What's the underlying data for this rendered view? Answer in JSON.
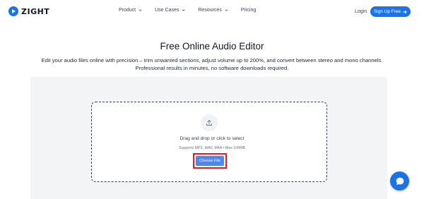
{
  "header": {
    "brand": "ZIGHT",
    "nav": [
      {
        "label": "Product",
        "has_dropdown": true
      },
      {
        "label": "Use Cases",
        "has_dropdown": true
      },
      {
        "label": "Resources",
        "has_dropdown": true
      },
      {
        "label": "Pricing",
        "has_dropdown": false
      }
    ],
    "login_label": "Login",
    "signup_label": "Sign Up Free"
  },
  "hero": {
    "title": "Free Online Audio Editor",
    "description": "Edit your audio files online with precision – trim unwanted sections, adjust volume up to 200%, and convert between stereo and mono channels. Professional results in minutes, no software downloads required."
  },
  "upload": {
    "drop_text": "Drag and drop or click to select",
    "supports_text": "Supports MP3, WAV, M4A • Max 100MB",
    "button_label": "Choose File"
  },
  "colors": {
    "brand_blue": "#1a73e8",
    "button_blue": "#4f86f0",
    "highlight_red": "#e11d2a",
    "panel_gray": "#f3f4f6"
  },
  "icons": {
    "logo": "zight-logo-icon",
    "upload": "upload-icon",
    "chat": "chat-icon",
    "arrow": "arrow-right-icon",
    "chevron": "chevron-down-icon"
  }
}
